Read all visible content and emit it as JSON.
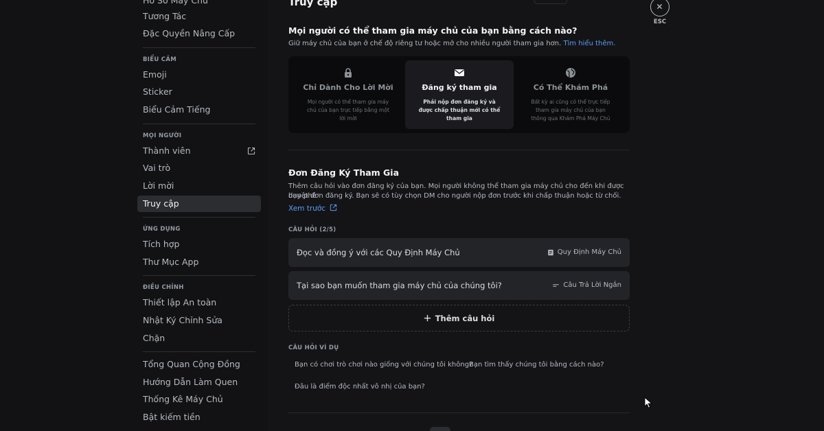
{
  "sidebar": {
    "top_items": [
      {
        "label": "Hồ Sơ Máy Chủ"
      },
      {
        "label": "Tương Tác"
      },
      {
        "label": "Đặc Quyền Nâng Cấp"
      }
    ],
    "sections": [
      {
        "header": "Biểu Cảm",
        "items": [
          {
            "label": "Emoji"
          },
          {
            "label": "Sticker"
          },
          {
            "label": "Biểu Cảm Tiếng"
          }
        ]
      },
      {
        "header": "Mọi Người",
        "items": [
          {
            "label": "Thành viên"
          },
          {
            "label": "Vai trò"
          },
          {
            "label": "Lời mời"
          },
          {
            "label": "Truy cập"
          }
        ]
      },
      {
        "header": "Ứng Dụng",
        "items": [
          {
            "label": "Tích hợp"
          },
          {
            "label": "Thư Mục App"
          }
        ]
      },
      {
        "header": "Điều Chỉnh",
        "items": [
          {
            "label": "Thiết lập An toàn"
          },
          {
            "label": "Nhật Ký Chỉnh Sửa"
          },
          {
            "label": "Chặn"
          }
        ]
      }
    ],
    "bottom_items": [
      {
        "label": "Tổng Quan Cộng Đồng"
      },
      {
        "label": "Hướng Dẫn Làm Quen"
      },
      {
        "label": "Thống Kê Máy Chủ"
      },
      {
        "label": "Bật kiếm tiền"
      }
    ],
    "active_item": "Truy cập"
  },
  "main": {
    "page_title": "Truy cập",
    "access": {
      "title": "Mọi người có thể tham gia máy chủ của bạn bằng cách nào?",
      "desc": "Giữ máy chủ của bạn ở chế độ riêng tư hoặc mở cho nhiều người tham gia hơn.",
      "learn_more": "Tìm hiểu thêm.",
      "options": [
        {
          "title": "Chỉ Dành Cho Lời Mời",
          "desc": "Mọi người có thể tham gia máy chủ của bạn trực tiếp bằng một lời mời",
          "icon": "lock-icon"
        },
        {
          "title": "Đăng ký tham gia",
          "desc": "Phải nộp đơn đăng ký và được chấp thuận mới có thể tham gia",
          "icon": "mail-icon"
        },
        {
          "title": "Có Thể Khám Phá",
          "desc": "Bất kỳ ai cũng có thể trực tiếp tham gia máy chủ của bạn thông qua Khám Phá Máy Chủ",
          "icon": "globe-icon"
        }
      ],
      "selected": "Đăng ký tham gia"
    },
    "application": {
      "title": "Đơn Đăng Ký Tham Gia",
      "desc_line1": "Thêm câu hỏi vào đơn đăng ký của bạn. Mọi người không thể tham gia máy chủ cho đến khi được bạn phê",
      "desc_line2": "duyệt đơn đăng ký. Bạn sẽ có tùy chọn DM cho người nộp đơn trước khi chấp thuận hoặc từ chối.",
      "preview_label": "Xem trước",
      "questions_header": "Câu Hỏi (2/5)",
      "questions": [
        {
          "text": "Đọc và đồng ý với các Quy Định Máy Chủ",
          "type": "Quy Định Máy Chủ",
          "icon": "rules-icon"
        },
        {
          "text": "Tại sao bạn muốn tham gia máy chủ của chúng tôi?",
          "type": "Câu Trả Lời Ngắn",
          "icon": "short-answer-icon"
        }
      ],
      "add_question": "Thêm câu hỏi",
      "examples_header": "Câu Hỏi Ví Dụ",
      "examples": [
        "Bạn có chơi trò chơi nào giống với chúng tôi không?",
        "Bạn tìm thấy chúng tôi bằng cách nào?",
        "Đâu là điểm độc nhất vô nhị của bạn?"
      ]
    }
  },
  "close": {
    "label": "ESC"
  },
  "colors": {
    "accent_link": "#5b9cf5",
    "background": "#141417",
    "sidebar": "#121214"
  }
}
